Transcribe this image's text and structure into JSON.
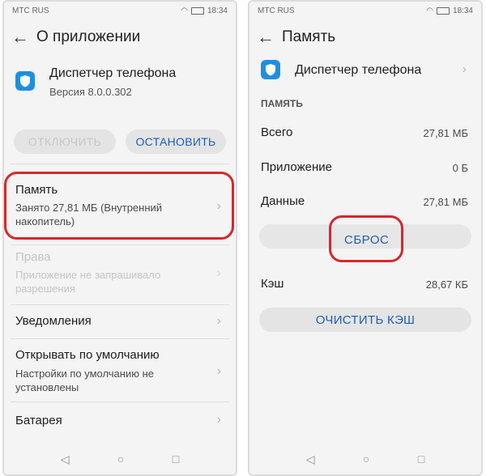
{
  "left": {
    "status": {
      "left": "МТС RUS",
      "time": "18:34"
    },
    "title": "О приложении",
    "app": {
      "name": "Диспетчер телефона",
      "version": "Версия 8.0.0.302"
    },
    "buttons": {
      "disable": "ОТКЛЮЧИТЬ",
      "stop": "ОСТАНОВИТЬ"
    },
    "items": [
      {
        "label": "Память",
        "sub": "Занято 27,81 МБ (Внутренний накопитель)"
      },
      {
        "label": "Права",
        "sub": "Приложению не запрашивало разрешения"
      },
      {
        "label": "Уведомления",
        "sub": ""
      },
      {
        "label": "Открывать по умолчанию",
        "sub": "Настройки по умолчанию не установлены"
      },
      {
        "label": "Батарея",
        "sub": ""
      }
    ],
    "sub_lines": {
      "memory_1": "Занято 27,81 МБ (Внутренний",
      "memory_2": "накопитель)",
      "perm_1": "Приложение не запрашивало",
      "perm_2": "разрешения",
      "default_1": "Настройки по умолчанию не",
      "default_2": "установлены"
    }
  },
  "right": {
    "status": {
      "left": "МТС RUS",
      "time": "18:34"
    },
    "title": "Память",
    "app_name": "Диспетчер телефона",
    "section": "ПАМЯТЬ",
    "rows": [
      {
        "label": "Всего",
        "value": "27,81 МБ"
      },
      {
        "label": "Приложение",
        "value": "0 Б"
      },
      {
        "label": "Данные",
        "value": "27,81 МБ"
      }
    ],
    "reset_button": "СБРОС",
    "cache": {
      "label": "Кэш",
      "value": "28,67 КБ"
    },
    "clear_cache_button": "ОЧИСТИТЬ КЭШ"
  },
  "nav": {
    "back": "◁",
    "home": "○",
    "recents": "□"
  },
  "colors": {
    "accent": "#1e5fb4",
    "highlight": "#d9262c",
    "app_icon": "#1e8fe0"
  }
}
